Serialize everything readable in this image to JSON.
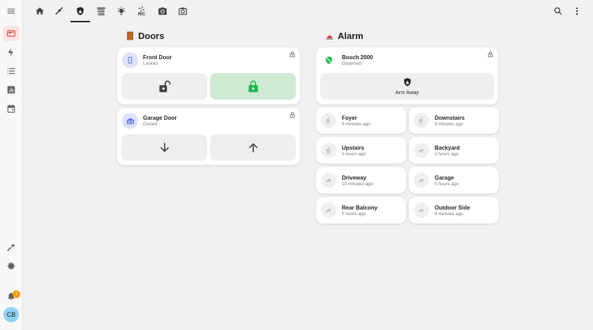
{
  "colors": {
    "accent_red": "#db4437",
    "unlock_dark": "#424242",
    "locked_green": "#1db954",
    "badge_orange": "#ff9800",
    "avatar_blue": "#8fd3f3"
  },
  "sidebar": {
    "items": [
      {
        "name": "menu",
        "icon": "menu-icon"
      },
      {
        "name": "dashboard",
        "icon": "dashboard-icon"
      },
      {
        "name": "energy",
        "icon": "lightning-icon"
      },
      {
        "name": "logbook",
        "icon": "list-icon"
      },
      {
        "name": "history",
        "icon": "chart-icon"
      },
      {
        "name": "calendar",
        "icon": "calendar-icon"
      },
      {
        "name": "developer-tools",
        "icon": "hammer-icon"
      },
      {
        "name": "settings",
        "icon": "gear-icon"
      },
      {
        "name": "notifications",
        "icon": "bell-icon"
      }
    ],
    "notification_count": "1",
    "user_initials": "CB"
  },
  "topbar": {
    "tabs": [
      {
        "name": "home",
        "icon": "home-icon"
      },
      {
        "name": "cleaning",
        "icon": "broom-icon"
      },
      {
        "name": "security",
        "icon": "shield-icon"
      },
      {
        "name": "garage",
        "icon": "garage-icon"
      },
      {
        "name": "lights",
        "icon": "bulb-icon"
      },
      {
        "name": "climate",
        "icon": "fan-icon",
        "label": "R/C"
      },
      {
        "name": "camera",
        "icon": "camera-icon"
      },
      {
        "name": "camera-alt",
        "icon": "camera-outline-icon"
      }
    ],
    "active_tab": "security"
  },
  "doors": {
    "title": "Doors",
    "front_door": {
      "name": "Front Door",
      "state": "Locked"
    },
    "garage_door": {
      "name": "Garage Door",
      "state": "Closed"
    }
  },
  "alarm": {
    "title": "Alarm",
    "panel": {
      "name": "Bosch 2000",
      "state": "Disarmed",
      "action_label": "Arm Away"
    },
    "sensors": [
      {
        "name": "Foyer",
        "time": "9 minutes ago",
        "icon": "walk-icon"
      },
      {
        "name": "Downstairs",
        "time": "9 minutes ago",
        "icon": "walk-icon"
      },
      {
        "name": "Upstairs",
        "time": "5 hours ago",
        "icon": "walk-icon"
      },
      {
        "name": "Backyard",
        "time": "3 hours ago",
        "icon": "motion-icon"
      },
      {
        "name": "Driveway",
        "time": "10 minutes ago",
        "icon": "motion-icon"
      },
      {
        "name": "Garage",
        "time": "5 hours ago",
        "icon": "motion-icon"
      },
      {
        "name": "Rear Balcony",
        "time": "5 hours ago",
        "icon": "motion-icon"
      },
      {
        "name": "Outdoor Side",
        "time": "9 minutes ago",
        "icon": "motion-icon"
      }
    ]
  }
}
